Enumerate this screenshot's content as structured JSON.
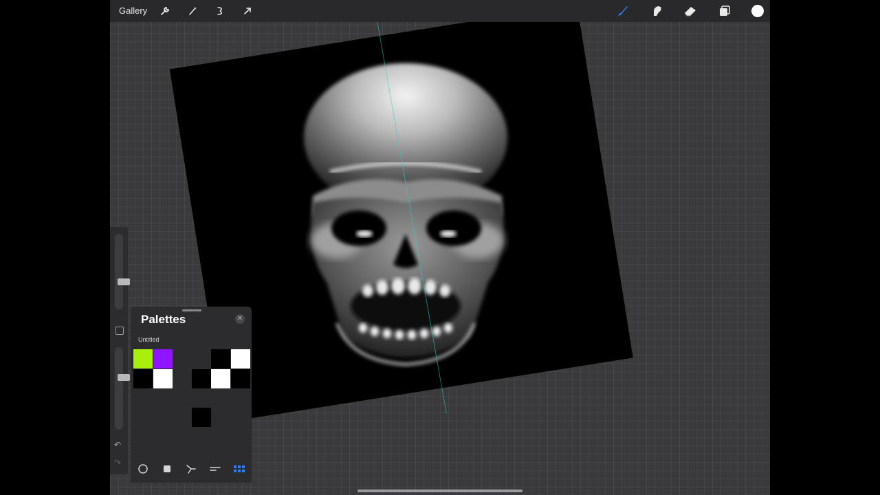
{
  "toolbar": {
    "gallery_label": "Gallery",
    "left_icons": [
      "wrench-icon",
      "magic-wand-icon",
      "selection-icon",
      "transform-arrow-icon"
    ],
    "right_icons": [
      "brush-icon",
      "smudge-icon",
      "eraser-icon",
      "layers-icon",
      "color-swatch-icon"
    ],
    "accent_color": "#2f7ff0",
    "current_color": "#ffffff"
  },
  "sidebar": {
    "undo_symbol": "↶",
    "redo_symbol": "↷",
    "brush_size": 0.35,
    "brush_opacity": 0.65
  },
  "color_panel": {
    "title": "Palettes",
    "close_symbol": "✕",
    "palette_name": "Untitled",
    "swatches": [
      {
        "color": "#a8ef0e"
      },
      {
        "color": "#8f14ff"
      },
      {
        "color": "#000000"
      },
      {
        "color": "#ffffff"
      },
      {
        "color": "#000000"
      },
      {
        "color": "#ffffff"
      },
      {
        "color": "#000000"
      },
      {
        "color": "#ffffff"
      },
      {
        "color": "#000000"
      },
      {
        "color": "#000000"
      }
    ],
    "tabs": [
      "disc-tab-icon",
      "classic-tab-icon",
      "harmony-tab-icon",
      "value-tab-icon",
      "palettes-tab-icon"
    ],
    "active_tab": "palettes-tab-icon"
  }
}
